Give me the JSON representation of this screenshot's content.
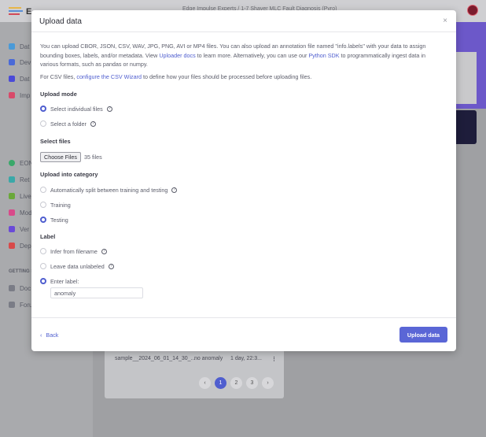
{
  "background": {
    "app_name": "E",
    "topbar_text": "Edge Impulse Experts / 1-7 Shaver MLC Fault Diagnosis (Pyro)",
    "sidebar": [
      "Dat",
      "Dev",
      "Dat",
      "Imp",
      "EON",
      "Ret",
      "Live",
      "Mod",
      "Ver",
      "Dep",
      "GETTING S",
      "Doc",
      "Foru"
    ],
    "table_row": {
      "name": "sample__2024_06_01_14_30_...",
      "label": "no anomaly",
      "date": "1 day, 22:3..."
    },
    "pages": [
      "1",
      "2",
      "3"
    ]
  },
  "modal": {
    "title": "Upload data",
    "close_icon": "×",
    "intro_parts": [
      "You can upload CBOR, JSON, CSV, WAV, JPG, PNG, AVI or MP4 files. You can also upload an annotation file named \"info.labels\" with your data to assign bounding boxes, labels, and/or metadata. View ",
      "Uploader docs",
      " to learn more. Alternatively, you can use our ",
      "Python SDK",
      " to programmatically ingest data in various formats, such as pandas or numpy."
    ],
    "csv_parts": [
      "For CSV files, ",
      "configure the CSV Wizard",
      " to define how your files should be processed before uploading files."
    ],
    "upload_mode": {
      "heading": "Upload mode",
      "options": [
        {
          "label": "Select individual files",
          "selected": true
        },
        {
          "label": "Select a folder",
          "selected": false
        }
      ]
    },
    "select_files": {
      "heading": "Select files",
      "button": "Choose Files",
      "status": "35 files"
    },
    "category": {
      "heading": "Upload into category",
      "options": [
        {
          "label": "Automatically split between training and testing",
          "selected": false
        },
        {
          "label": "Training",
          "selected": false
        },
        {
          "label": "Testing",
          "selected": true
        }
      ]
    },
    "label": {
      "heading": "Label",
      "options": [
        {
          "label": "Infer from filename",
          "selected": false
        },
        {
          "label": "Leave data unlabeled",
          "selected": false
        },
        {
          "label": "Enter label:",
          "selected": true
        }
      ],
      "input_value": "anomaly"
    },
    "footer": {
      "back": "Back",
      "back_icon": "‹",
      "submit": "Upload data"
    }
  },
  "colors": {
    "accent": "#4f5ecf",
    "button": "#5a66d6"
  }
}
